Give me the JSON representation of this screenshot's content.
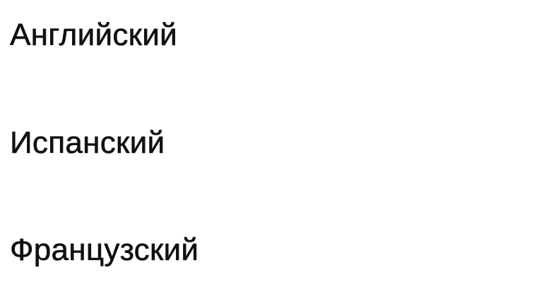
{
  "language_menu": {
    "items": [
      {
        "label": "Английский"
      },
      {
        "label": "Испанский"
      },
      {
        "label": "Французский"
      }
    ]
  }
}
